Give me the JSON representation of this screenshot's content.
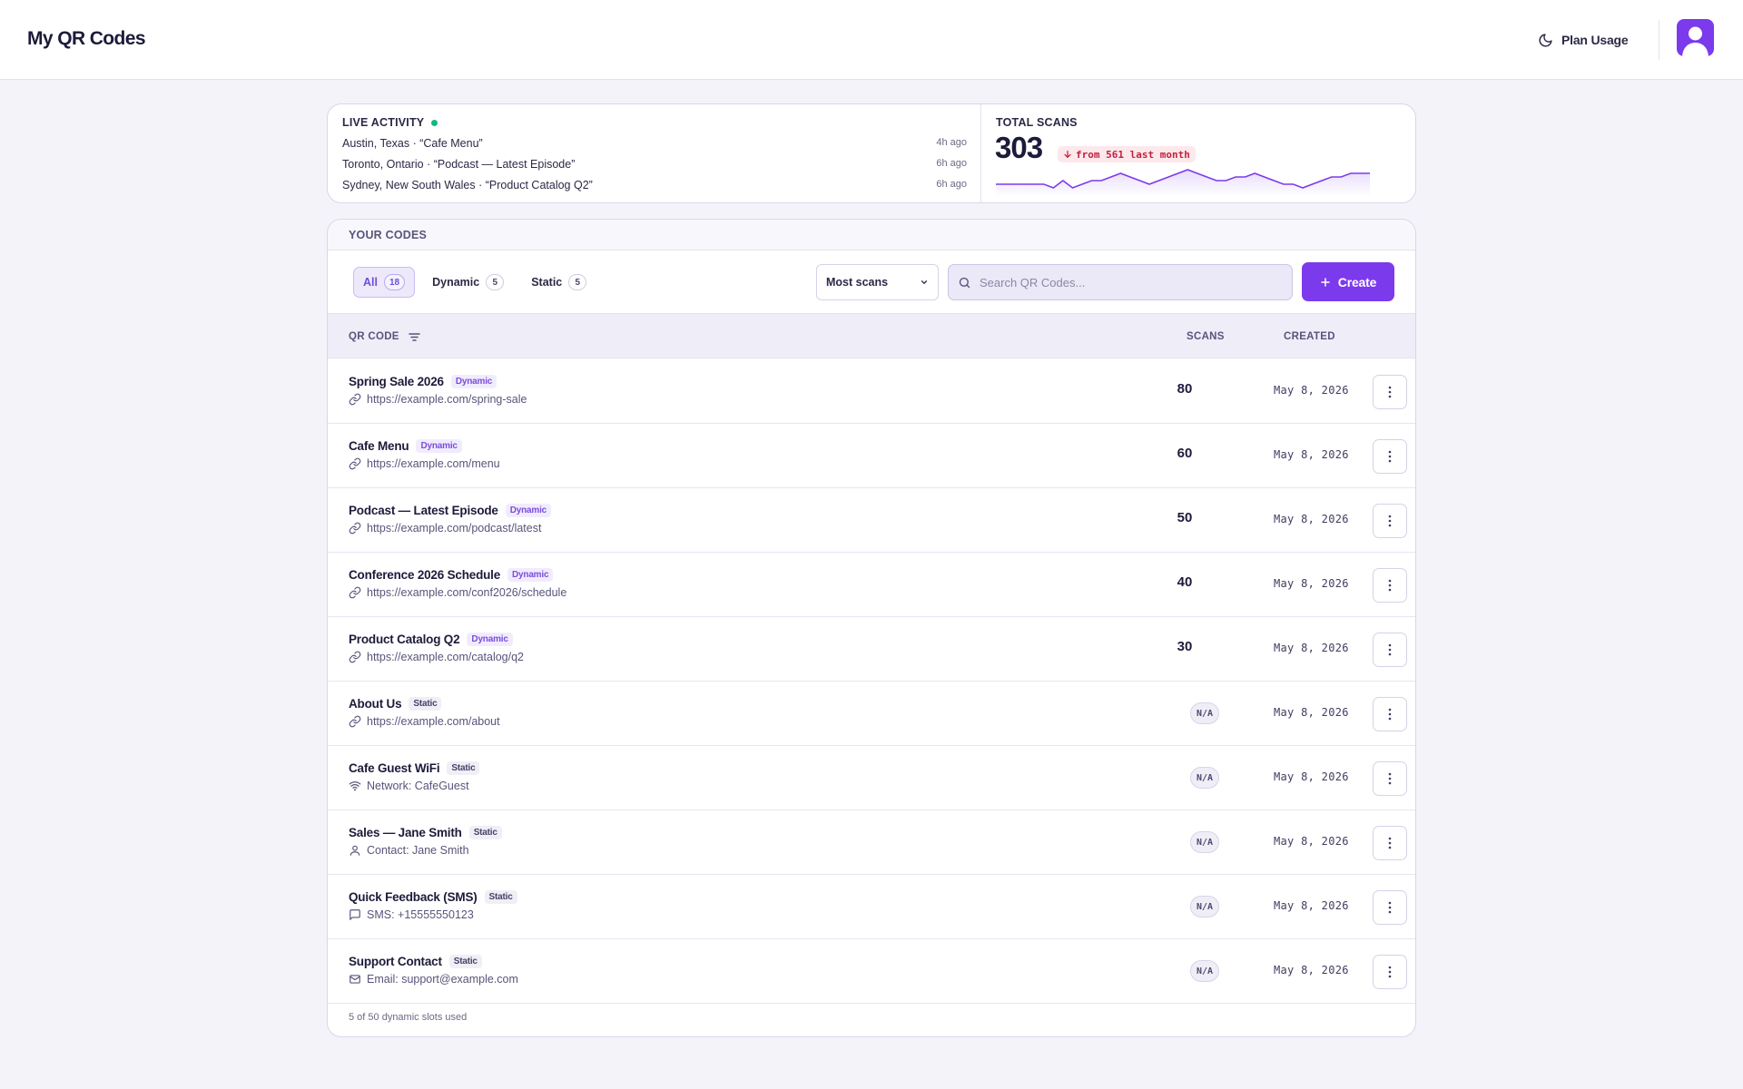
{
  "header": {
    "title": "My QR Codes",
    "plan_usage": "Plan Usage"
  },
  "live_activity": {
    "label": "LIVE ACTIVITY",
    "items": [
      {
        "text": "Austin, Texas · “Cafe Menu”",
        "time": "4h ago"
      },
      {
        "text": "Toronto, Ontario · “Podcast — Latest Episode”",
        "time": "6h ago"
      },
      {
        "text": "Sydney, New South Wales · “Product Catalog Q2”",
        "time": "6h ago"
      }
    ]
  },
  "total_scans": {
    "label": "TOTAL SCANS",
    "value": "303",
    "trend": "from 561 last month",
    "trend_color": "#c0213e",
    "sparkline": [
      5,
      5,
      5,
      5,
      5,
      5,
      6,
      4,
      6,
      5,
      4,
      4,
      3,
      2,
      3,
      4,
      5,
      4,
      3,
      2,
      1,
      2,
      3,
      4,
      4,
      3,
      3,
      2,
      3,
      4,
      5,
      5,
      6,
      5,
      4,
      3,
      3,
      2,
      2,
      2
    ]
  },
  "codes": {
    "label": "YOUR CODES",
    "filters": [
      {
        "label": "All",
        "count": "18",
        "active": true
      },
      {
        "label": "Dynamic",
        "count": "5",
        "active": false
      },
      {
        "label": "Static",
        "count": "5",
        "active": false
      }
    ],
    "sort": {
      "selected": "Most scans"
    },
    "search": {
      "placeholder": "Search QR Codes..."
    },
    "create_label": "Create",
    "columns": {
      "name": "QR CODE",
      "scans": "SCANS",
      "created": "CREATED"
    },
    "rows": [
      {
        "name": "Spring Sale 2026",
        "type": "Dynamic",
        "icon": "link-icon",
        "sub": "https://example.com/spring-sale",
        "scans": "80",
        "created": "May 8, 2026"
      },
      {
        "name": "Cafe Menu",
        "type": "Dynamic",
        "icon": "link-icon",
        "sub": "https://example.com/menu",
        "scans": "60",
        "created": "May 8, 2026"
      },
      {
        "name": "Podcast — Latest Episode",
        "type": "Dynamic",
        "icon": "link-icon",
        "sub": "https://example.com/podcast/latest",
        "scans": "50",
        "created": "May 8, 2026"
      },
      {
        "name": "Conference 2026 Schedule",
        "type": "Dynamic",
        "icon": "link-icon",
        "sub": "https://example.com/conf2026/schedule",
        "scans": "40",
        "created": "May 8, 2026"
      },
      {
        "name": "Product Catalog Q2",
        "type": "Dynamic",
        "icon": "link-icon",
        "sub": "https://example.com/catalog/q2",
        "scans": "30",
        "created": "May 8, 2026"
      },
      {
        "name": "About Us",
        "type": "Static",
        "icon": "link-icon",
        "sub": "https://example.com/about",
        "scans": "N/A",
        "created": "May 8, 2026"
      },
      {
        "name": "Cafe Guest WiFi",
        "type": "Static",
        "icon": "wifi-icon",
        "sub": "Network: CafeGuest",
        "scans": "N/A",
        "created": "May 8, 2026"
      },
      {
        "name": "Sales — Jane Smith",
        "type": "Static",
        "icon": "user-icon",
        "sub": "Contact: Jane Smith",
        "scans": "N/A",
        "created": "May 8, 2026"
      },
      {
        "name": "Quick Feedback (SMS)",
        "type": "Static",
        "icon": "message-icon",
        "sub": "SMS: +15555550123",
        "scans": "N/A",
        "created": "May 8, 2026"
      },
      {
        "name": "Support Contact",
        "type": "Static",
        "icon": "mail-icon",
        "sub": "Email: support@example.com",
        "scans": "N/A",
        "created": "May 8, 2026"
      }
    ],
    "footer": "5 of 50 dynamic slots used"
  },
  "colors": {
    "accent": "#7c3aed",
    "live_dot": "#10b981",
    "background": "#f4f3fa"
  }
}
